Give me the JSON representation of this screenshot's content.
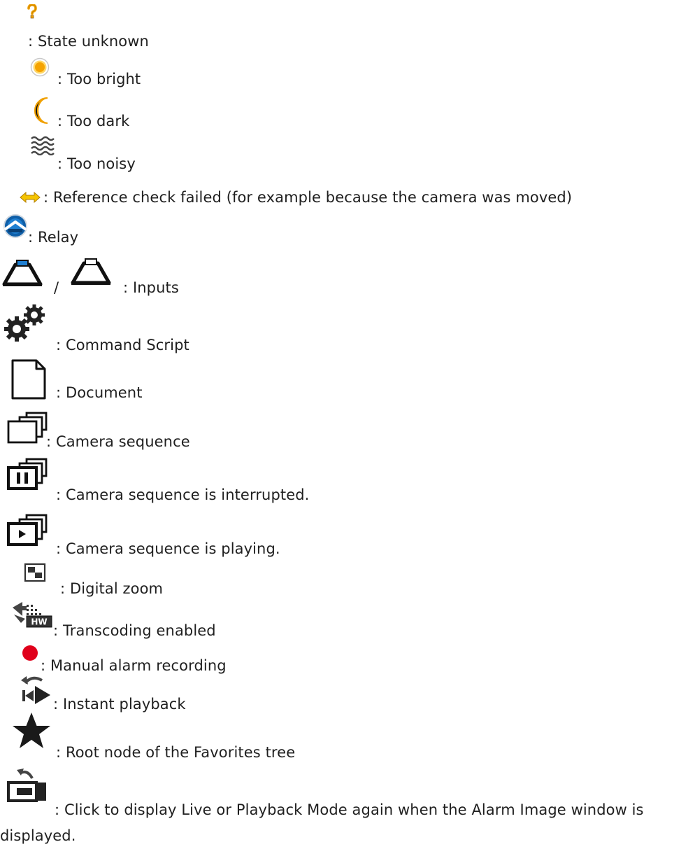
{
  "items": [
    {
      "icon": "question-icon",
      "text": ": State unknown"
    },
    {
      "icon": "sun-icon",
      "text": ": Too bright"
    },
    {
      "icon": "moon-icon",
      "text": ": Too dark"
    },
    {
      "icon": "noise-icon",
      "text": ": Too noisy"
    },
    {
      "icon": "double-arrow-icon",
      "text": ": Reference check failed (for example because the camera was moved)"
    },
    {
      "icon": "relay-icon",
      "text": ": Relay"
    },
    {
      "icon": "input-active-icon",
      "icon2": "input-inactive-icon",
      "separator": "/",
      "text": ": Inputs"
    },
    {
      "icon": "gears-icon",
      "text": ": Command Script"
    },
    {
      "icon": "document-icon",
      "text": ": Document"
    },
    {
      "icon": "camera-sequence-icon",
      "text": ": Camera sequence"
    },
    {
      "icon": "camera-sequence-paused-icon",
      "text": ": Camera sequence is interrupted."
    },
    {
      "icon": "camera-sequence-playing-icon",
      "text": ": Camera sequence is playing."
    },
    {
      "icon": "digital-zoom-icon",
      "text": ": Digital zoom"
    },
    {
      "icon": "transcoding-hw-icon",
      "text": ": Transcoding enabled"
    },
    {
      "icon": "record-dot-icon",
      "text": ": Manual alarm recording"
    },
    {
      "icon": "instant-playback-icon",
      "text": ": Instant playback"
    },
    {
      "icon": "star-icon",
      "text": ": Root node of the Favorites tree"
    },
    {
      "icon": "back-to-live-icon",
      "text": ": Click to display Live or Playback Mode again when the Alarm Image window is displayed."
    }
  ],
  "colors": {
    "text": "#1f1f1f",
    "accent_orange": "#f5a300",
    "relay_blue": "#1f7fd1",
    "input_blue": "#2b7fce",
    "record_red": "#e0001b"
  }
}
